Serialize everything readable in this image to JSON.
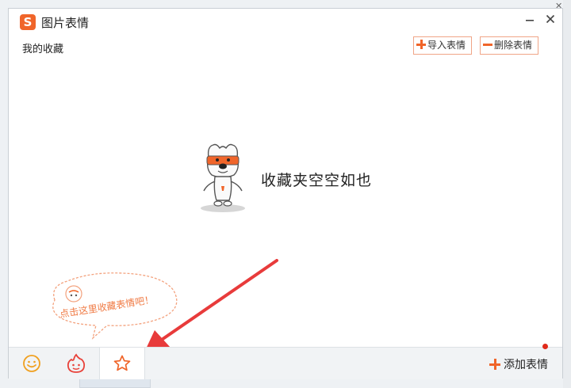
{
  "window": {
    "title": "图片表情",
    "logo_letter": "S"
  },
  "section": {
    "label": "我的收藏"
  },
  "toolbar": {
    "import_label": "导入表情",
    "delete_label": "删除表情"
  },
  "empty_state": {
    "message": "收藏夹空空如也"
  },
  "hint": {
    "text": "点击这里收藏表情吧！"
  },
  "bottom_tabs": [
    {
      "name": "emoji",
      "icon": "smiley-icon"
    },
    {
      "name": "hot",
      "icon": "flame-face-icon"
    },
    {
      "name": "favorites",
      "icon": "star-icon",
      "active": true
    }
  ],
  "add_button": {
    "label": "添加表情"
  },
  "colors": {
    "accent": "#f0652a",
    "arrow": "#e83b3b",
    "notification_dot": "#e02a1a"
  }
}
